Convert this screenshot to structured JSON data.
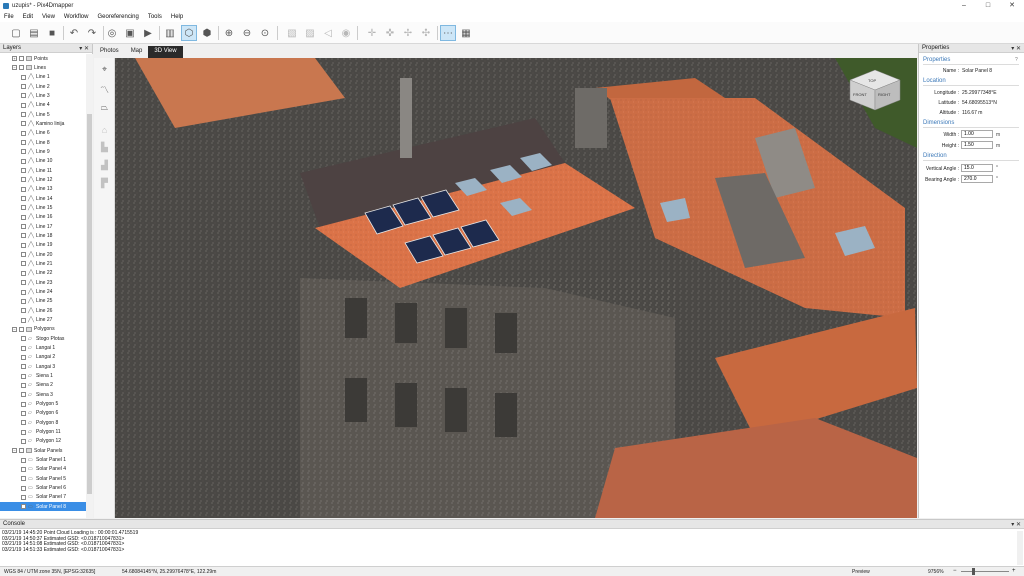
{
  "window": {
    "title": "uzupis* - Pix4Dmapper",
    "controls": {
      "minimize": "–",
      "maximize": "□",
      "close": "✕"
    }
  },
  "menu": {
    "items": [
      "File",
      "Edit",
      "View",
      "Workflow",
      "Georeferencing",
      "Tools",
      "Help"
    ]
  },
  "layers": {
    "title": "Layers",
    "pins": "▾ ✕",
    "rows": [
      {
        "label": "Points",
        "level": 1,
        "expander": "+",
        "kind": "group"
      },
      {
        "label": "Lines",
        "level": 1,
        "expander": "−",
        "kind": "group"
      },
      {
        "label": "Line 1",
        "level": 2,
        "kind": "line"
      },
      {
        "label": "Line 2",
        "level": 2,
        "kind": "line"
      },
      {
        "label": "Line 3",
        "level": 2,
        "kind": "line"
      },
      {
        "label": "Line 4",
        "level": 2,
        "kind": "line"
      },
      {
        "label": "Line 5",
        "level": 2,
        "kind": "line"
      },
      {
        "label": "Kamino linija",
        "level": 2,
        "kind": "line"
      },
      {
        "label": "Line 6",
        "level": 2,
        "kind": "line"
      },
      {
        "label": "Line 8",
        "level": 2,
        "kind": "line"
      },
      {
        "label": "Line 9",
        "level": 2,
        "kind": "line"
      },
      {
        "label": "Line 10",
        "level": 2,
        "kind": "line"
      },
      {
        "label": "Line 11",
        "level": 2,
        "kind": "line"
      },
      {
        "label": "Line 12",
        "level": 2,
        "kind": "line"
      },
      {
        "label": "Line 13",
        "level": 2,
        "kind": "line"
      },
      {
        "label": "Line 14",
        "level": 2,
        "kind": "line"
      },
      {
        "label": "Line 15",
        "level": 2,
        "kind": "line"
      },
      {
        "label": "Line 16",
        "level": 2,
        "kind": "line"
      },
      {
        "label": "Line 17",
        "level": 2,
        "kind": "line"
      },
      {
        "label": "Line 18",
        "level": 2,
        "kind": "line"
      },
      {
        "label": "Line 19",
        "level": 2,
        "kind": "line"
      },
      {
        "label": "Line 20",
        "level": 2,
        "kind": "line"
      },
      {
        "label": "Line 21",
        "level": 2,
        "kind": "line"
      },
      {
        "label": "Line 22",
        "level": 2,
        "kind": "line"
      },
      {
        "label": "Line 23",
        "level": 2,
        "kind": "line"
      },
      {
        "label": "Line 24",
        "level": 2,
        "kind": "line"
      },
      {
        "label": "Line 25",
        "level": 2,
        "kind": "line"
      },
      {
        "label": "Line 26",
        "level": 2,
        "kind": "line"
      },
      {
        "label": "Line 27",
        "level": 2,
        "kind": "line"
      },
      {
        "label": "Polygons",
        "level": 1,
        "expander": "−",
        "kind": "group"
      },
      {
        "label": "Stogo Plotas",
        "level": 2,
        "kind": "poly"
      },
      {
        "label": "Langai 1",
        "level": 2,
        "kind": "poly"
      },
      {
        "label": "Langai 2",
        "level": 2,
        "kind": "poly"
      },
      {
        "label": "Langai 3",
        "level": 2,
        "kind": "poly"
      },
      {
        "label": "Siena 1",
        "level": 2,
        "kind": "poly"
      },
      {
        "label": "Siena 2",
        "level": 2,
        "kind": "poly"
      },
      {
        "label": "Siena 3",
        "level": 2,
        "kind": "poly"
      },
      {
        "label": "Polygon 5",
        "level": 2,
        "kind": "poly"
      },
      {
        "label": "Polygon 6",
        "level": 2,
        "kind": "poly"
      },
      {
        "label": "Polygon 8",
        "level": 2,
        "kind": "poly"
      },
      {
        "label": "Polygon 11",
        "level": 2,
        "kind": "poly"
      },
      {
        "label": "Polygon 12",
        "level": 2,
        "kind": "poly"
      },
      {
        "label": "Solar Panels",
        "level": 1,
        "expander": "−",
        "kind": "group"
      },
      {
        "label": "Solar Panel 1",
        "level": 2,
        "kind": "panel"
      },
      {
        "label": "Solar Panel 4",
        "level": 2,
        "kind": "panel"
      },
      {
        "label": "Solar Panel 5",
        "level": 2,
        "kind": "panel"
      },
      {
        "label": "Solar Panel 6",
        "level": 2,
        "kind": "panel"
      },
      {
        "label": "Solar Panel 7",
        "level": 2,
        "kind": "panel"
      },
      {
        "label": "Solar Panel 8",
        "level": 2,
        "kind": "panel",
        "selected": true
      }
    ]
  },
  "viewer": {
    "tabs": [
      "Photos",
      "Map",
      "3D View"
    ],
    "active_tab": "3D View",
    "nav_cube": {
      "top": "TOP",
      "front": "FRONT",
      "right": "RIGHT"
    }
  },
  "properties": {
    "title": "Properties",
    "pins": "▾ ✕",
    "properties_section": "Properties",
    "help": "?",
    "name_label": "Name :",
    "name_value": "Solar Panel 8",
    "location_section": "Location",
    "longitude_label": "Longitude :",
    "longitude_value": "25.29977348°E",
    "latitude_label": "Latitude :",
    "latitude_value": "54.68095513°N",
    "altitude_label": "Altitude :",
    "altitude_value": "116.67 m",
    "dimensions_section": "Dimensions",
    "width_label": "Width :",
    "width_value": "1.00",
    "width_unit": "m",
    "height_label": "Height :",
    "height_value": "1.50",
    "height_unit": "m",
    "direction_section": "Direction",
    "vertical_angle_label": "Vertical Angle :",
    "vertical_angle_value": "15.0",
    "vertical_angle_unit": "°",
    "bearing_angle_label": "Bearing Angle :",
    "bearing_angle_value": "270.0",
    "bearing_angle_unit": "°"
  },
  "console": {
    "title": "Console",
    "pins": "▾ ✕",
    "lines": [
      "03/21/19 14:45:20  Point Cloud Loading is : 00:00:01.4715519",
      "03/21/19 14:50:37  Estimated GSD: <0.018710047831>",
      "03/21/19 14:51:08  Estimated GSD: <0.018710047831>",
      "03/21/19 14:51:33  Estimated GSD: <0.018710047831>"
    ]
  },
  "status": {
    "crs": "WGS 84 / UTM zone 35N, [EPSG:32635]",
    "coords": "54.68084145°N, 25.29976478°E, 122.29m",
    "mode": "Preview",
    "zoom": "9756%"
  },
  "colors": {
    "accent": "#3a8ee6",
    "roof": "#d9734f",
    "panel": "#1d2a4d",
    "section": "#3b78b8"
  }
}
